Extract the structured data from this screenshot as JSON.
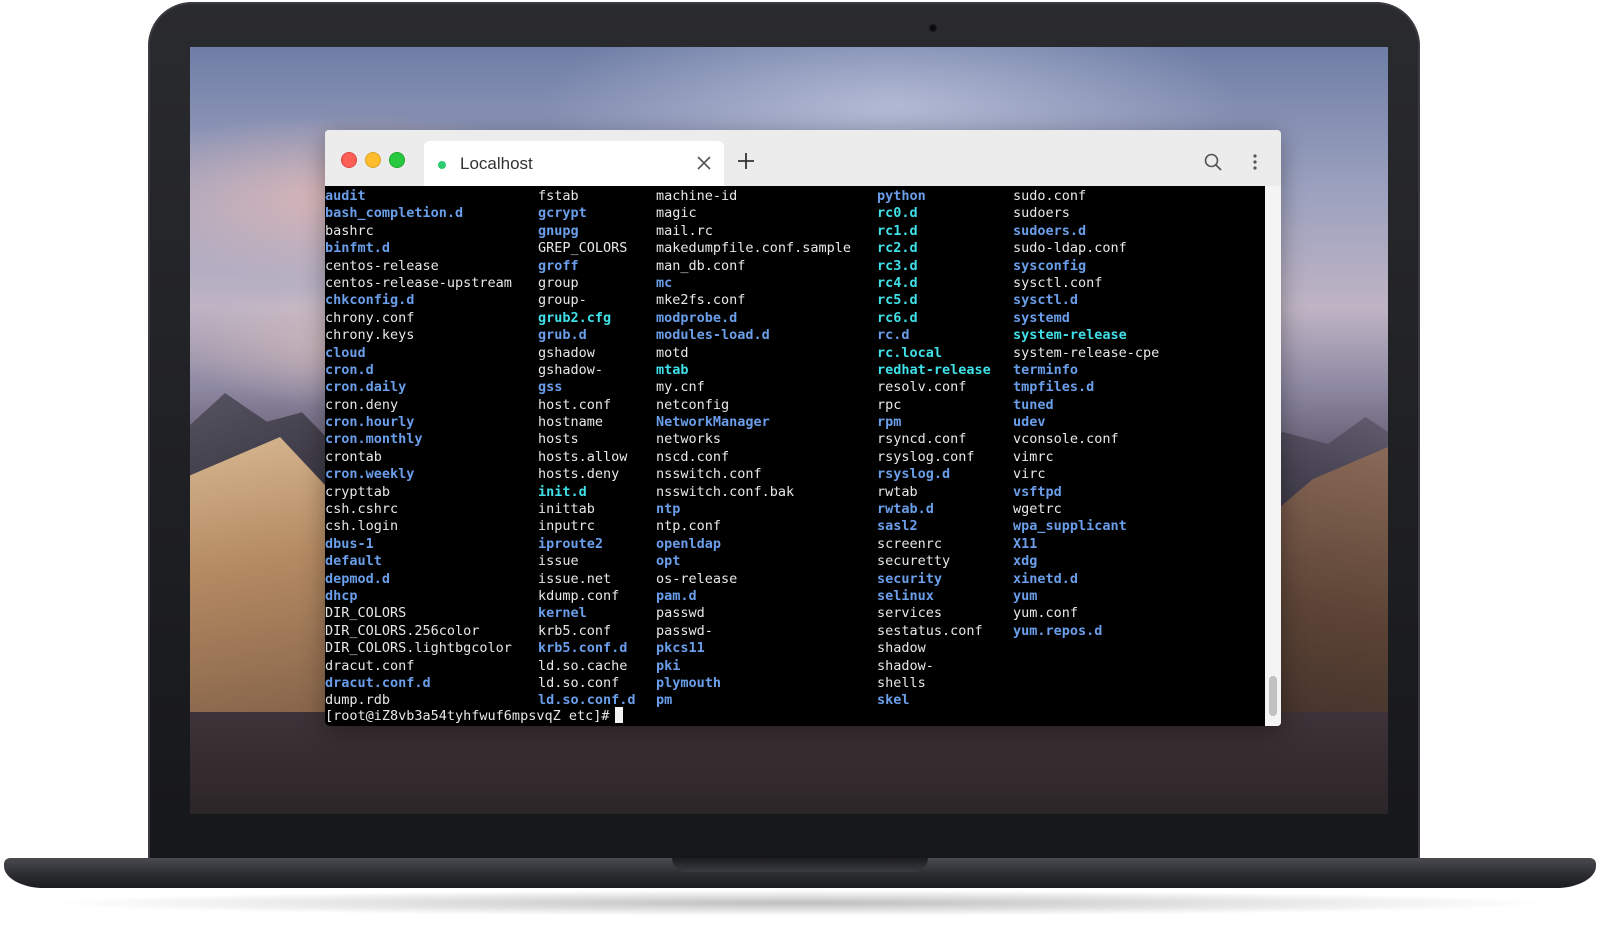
{
  "browser": {
    "tab_title": "Localhost",
    "new_tab_glyph": "+",
    "icons": [
      "close-icon",
      "plus-icon",
      "search-icon",
      "more-vertical-icon"
    ]
  },
  "colors": {
    "file": "#e8e8e8",
    "directory": "#6a9eea",
    "link": "#3fe0e8",
    "background": "#000000"
  },
  "terminal": {
    "columns": [
      [
        {
          "name": "audit",
          "type": "d"
        },
        {
          "name": "bash_completion.d",
          "type": "d"
        },
        {
          "name": "bashrc",
          "type": "f"
        },
        {
          "name": "binfmt.d",
          "type": "d"
        },
        {
          "name": "centos-release",
          "type": "f"
        },
        {
          "name": "centos-release-upstream",
          "type": "f"
        },
        {
          "name": "chkconfig.d",
          "type": "d"
        },
        {
          "name": "chrony.conf",
          "type": "f"
        },
        {
          "name": "chrony.keys",
          "type": "f"
        },
        {
          "name": "cloud",
          "type": "d"
        },
        {
          "name": "cron.d",
          "type": "d"
        },
        {
          "name": "cron.daily",
          "type": "d"
        },
        {
          "name": "cron.deny",
          "type": "f"
        },
        {
          "name": "cron.hourly",
          "type": "d"
        },
        {
          "name": "cron.monthly",
          "type": "d"
        },
        {
          "name": "crontab",
          "type": "f"
        },
        {
          "name": "cron.weekly",
          "type": "d"
        },
        {
          "name": "crypttab",
          "type": "f"
        },
        {
          "name": "csh.cshrc",
          "type": "f"
        },
        {
          "name": "csh.login",
          "type": "f"
        },
        {
          "name": "dbus-1",
          "type": "d"
        },
        {
          "name": "default",
          "type": "d"
        },
        {
          "name": "depmod.d",
          "type": "d"
        },
        {
          "name": "dhcp",
          "type": "d"
        },
        {
          "name": "DIR_COLORS",
          "type": "f"
        },
        {
          "name": "DIR_COLORS.256color",
          "type": "f"
        },
        {
          "name": "DIR_COLORS.lightbgcolor",
          "type": "f"
        },
        {
          "name": "dracut.conf",
          "type": "f"
        },
        {
          "name": "dracut.conf.d",
          "type": "d"
        },
        {
          "name": "dump.rdb",
          "type": "f"
        }
      ],
      [
        {
          "name": "fstab",
          "type": "f"
        },
        {
          "name": "gcrypt",
          "type": "d"
        },
        {
          "name": "gnupg",
          "type": "d"
        },
        {
          "name": "GREP_COLORS",
          "type": "f"
        },
        {
          "name": "groff",
          "type": "d"
        },
        {
          "name": "group",
          "type": "f"
        },
        {
          "name": "group-",
          "type": "f"
        },
        {
          "name": "grub2.cfg",
          "type": "l"
        },
        {
          "name": "grub.d",
          "type": "d"
        },
        {
          "name": "gshadow",
          "type": "f"
        },
        {
          "name": "gshadow-",
          "type": "f"
        },
        {
          "name": "gss",
          "type": "d"
        },
        {
          "name": "host.conf",
          "type": "f"
        },
        {
          "name": "hostname",
          "type": "f"
        },
        {
          "name": "hosts",
          "type": "f"
        },
        {
          "name": "hosts.allow",
          "type": "f"
        },
        {
          "name": "hosts.deny",
          "type": "f"
        },
        {
          "name": "init.d",
          "type": "l"
        },
        {
          "name": "inittab",
          "type": "f"
        },
        {
          "name": "inputrc",
          "type": "f"
        },
        {
          "name": "iproute2",
          "type": "d"
        },
        {
          "name": "issue",
          "type": "f"
        },
        {
          "name": "issue.net",
          "type": "f"
        },
        {
          "name": "kdump.conf",
          "type": "f"
        },
        {
          "name": "kernel",
          "type": "d"
        },
        {
          "name": "krb5.conf",
          "type": "f"
        },
        {
          "name": "krb5.conf.d",
          "type": "d"
        },
        {
          "name": "ld.so.cache",
          "type": "f"
        },
        {
          "name": "ld.so.conf",
          "type": "f"
        },
        {
          "name": "ld.so.conf.d",
          "type": "d"
        }
      ],
      [
        {
          "name": "machine-id",
          "type": "f"
        },
        {
          "name": "magic",
          "type": "f"
        },
        {
          "name": "mail.rc",
          "type": "f"
        },
        {
          "name": "makedumpfile.conf.sample",
          "type": "f"
        },
        {
          "name": "man_db.conf",
          "type": "f"
        },
        {
          "name": "mc",
          "type": "d"
        },
        {
          "name": "mke2fs.conf",
          "type": "f"
        },
        {
          "name": "modprobe.d",
          "type": "d"
        },
        {
          "name": "modules-load.d",
          "type": "d"
        },
        {
          "name": "motd",
          "type": "f"
        },
        {
          "name": "mtab",
          "type": "l"
        },
        {
          "name": "my.cnf",
          "type": "f"
        },
        {
          "name": "netconfig",
          "type": "f"
        },
        {
          "name": "NetworkManager",
          "type": "d"
        },
        {
          "name": "networks",
          "type": "f"
        },
        {
          "name": "nscd.conf",
          "type": "f"
        },
        {
          "name": "nsswitch.conf",
          "type": "f"
        },
        {
          "name": "nsswitch.conf.bak",
          "type": "f"
        },
        {
          "name": "ntp",
          "type": "d"
        },
        {
          "name": "ntp.conf",
          "type": "f"
        },
        {
          "name": "openldap",
          "type": "d"
        },
        {
          "name": "opt",
          "type": "d"
        },
        {
          "name": "os-release",
          "type": "f"
        },
        {
          "name": "pam.d",
          "type": "d"
        },
        {
          "name": "passwd",
          "type": "f"
        },
        {
          "name": "passwd-",
          "type": "f"
        },
        {
          "name": "pkcs11",
          "type": "d"
        },
        {
          "name": "pki",
          "type": "d"
        },
        {
          "name": "plymouth",
          "type": "d"
        },
        {
          "name": "pm",
          "type": "d"
        }
      ],
      [
        {
          "name": "python",
          "type": "d"
        },
        {
          "name": "rc0.d",
          "type": "l"
        },
        {
          "name": "rc1.d",
          "type": "l"
        },
        {
          "name": "rc2.d",
          "type": "l"
        },
        {
          "name": "rc3.d",
          "type": "l"
        },
        {
          "name": "rc4.d",
          "type": "l"
        },
        {
          "name": "rc5.d",
          "type": "l"
        },
        {
          "name": "rc6.d",
          "type": "l"
        },
        {
          "name": "rc.d",
          "type": "d"
        },
        {
          "name": "rc.local",
          "type": "l"
        },
        {
          "name": "redhat-release",
          "type": "l"
        },
        {
          "name": "resolv.conf",
          "type": "f"
        },
        {
          "name": "rpc",
          "type": "f"
        },
        {
          "name": "rpm",
          "type": "d"
        },
        {
          "name": "rsyncd.conf",
          "type": "f"
        },
        {
          "name": "rsyslog.conf",
          "type": "f"
        },
        {
          "name": "rsyslog.d",
          "type": "d"
        },
        {
          "name": "rwtab",
          "type": "f"
        },
        {
          "name": "rwtab.d",
          "type": "d"
        },
        {
          "name": "sasl2",
          "type": "d"
        },
        {
          "name": "screenrc",
          "type": "f"
        },
        {
          "name": "securetty",
          "type": "f"
        },
        {
          "name": "security",
          "type": "d"
        },
        {
          "name": "selinux",
          "type": "d"
        },
        {
          "name": "services",
          "type": "f"
        },
        {
          "name": "sestatus.conf",
          "type": "f"
        },
        {
          "name": "shadow",
          "type": "f"
        },
        {
          "name": "shadow-",
          "type": "f"
        },
        {
          "name": "shells",
          "type": "f"
        },
        {
          "name": "skel",
          "type": "d"
        }
      ],
      [
        {
          "name": "sudo.conf",
          "type": "f"
        },
        {
          "name": "sudoers",
          "type": "f"
        },
        {
          "name": "sudoers.d",
          "type": "d"
        },
        {
          "name": "sudo-ldap.conf",
          "type": "f"
        },
        {
          "name": "sysconfig",
          "type": "d"
        },
        {
          "name": "sysctl.conf",
          "type": "f"
        },
        {
          "name": "sysctl.d",
          "type": "d"
        },
        {
          "name": "systemd",
          "type": "d"
        },
        {
          "name": "system-release",
          "type": "l"
        },
        {
          "name": "system-release-cpe",
          "type": "f"
        },
        {
          "name": "terminfo",
          "type": "d"
        },
        {
          "name": "tmpfiles.d",
          "type": "d"
        },
        {
          "name": "tuned",
          "type": "d"
        },
        {
          "name": "udev",
          "type": "d"
        },
        {
          "name": "vconsole.conf",
          "type": "f"
        },
        {
          "name": "vimrc",
          "type": "f"
        },
        {
          "name": "virc",
          "type": "f"
        },
        {
          "name": "vsftpd",
          "type": "d"
        },
        {
          "name": "wgetrc",
          "type": "f"
        },
        {
          "name": "wpa_supplicant",
          "type": "d"
        },
        {
          "name": "X11",
          "type": "d"
        },
        {
          "name": "xdg",
          "type": "d"
        },
        {
          "name": "xinetd.d",
          "type": "d"
        },
        {
          "name": "yum",
          "type": "d"
        },
        {
          "name": "yum.conf",
          "type": "f"
        },
        {
          "name": "yum.repos.d",
          "type": "d"
        }
      ]
    ],
    "prompt": "[root@iZ8vb3a54tyhfwuf6mpsvqZ etc]#"
  }
}
